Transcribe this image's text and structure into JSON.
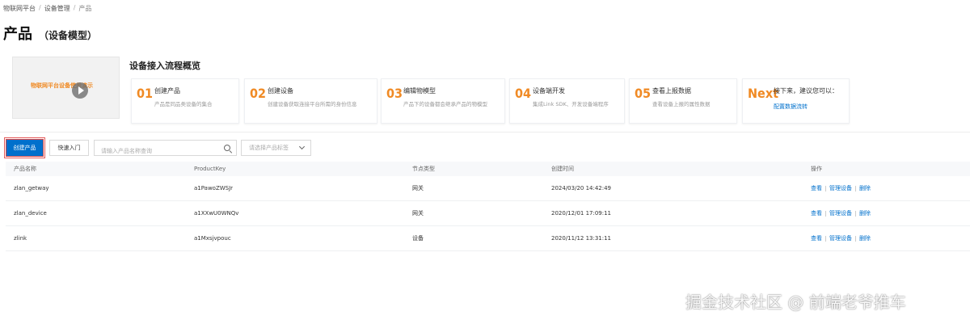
{
  "breadcrumb": [
    "物联网平台",
    "设备管理",
    "产品"
  ],
  "title": {
    "main": "产品",
    "sub": "（设备模型）"
  },
  "video": {
    "caption": "物联网平台设备使用演示"
  },
  "flow": {
    "title": "设备接入流程概览",
    "steps": [
      {
        "num": "01",
        "title": "创建产品",
        "desc": "产品是同品类设备的集合"
      },
      {
        "num": "02",
        "title": "创建设备",
        "desc": "创建设备获取连接平台所需的身份信息"
      },
      {
        "num": "03",
        "title": "编辑物模型",
        "desc": "产品下的设备都会继承产品的物模型"
      },
      {
        "num": "04",
        "title": "设备端开发",
        "desc": "集成Link SDK、开发设备端程序"
      },
      {
        "num": "05",
        "title": "查看上报数据",
        "desc": "查看设备上报的属性数据"
      },
      {
        "num": "Next",
        "title": "接下来，建议您可以：",
        "link": "配置数据流转"
      }
    ]
  },
  "toolbar": {
    "create_label": "创建产品",
    "quick_label": "快速入门",
    "search_placeholder": "请输入产品名称查询",
    "tag_placeholder": "请选择产品标签"
  },
  "table": {
    "headers": [
      "产品名称",
      "ProductKey",
      "节点类型",
      "创建时间",
      "操作"
    ],
    "rows": [
      {
        "name": "zlan_getway",
        "key": "a1PawoZWSJr",
        "type": "网关",
        "time": "2024/03/20 14:42:49"
      },
      {
        "name": "zlan_device",
        "key": "a1XXwU0WNQv",
        "type": "网关",
        "time": "2020/12/01 17:09:11"
      },
      {
        "name": "zlink",
        "key": "a1Mxsjvpouc",
        "type": "设备",
        "time": "2020/11/12 13:31:11"
      }
    ],
    "actions": [
      "查看",
      "管理设备",
      "删除"
    ]
  },
  "watermark": "掘金技术社区 @ 前端老爷推车",
  "colors": {
    "primary": "#0070cc",
    "accent": "#f08a24"
  }
}
